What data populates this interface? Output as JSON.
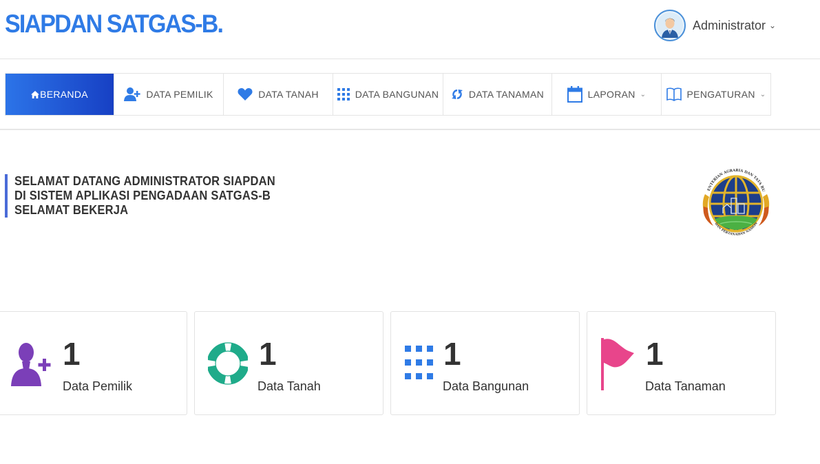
{
  "header": {
    "brand": "SIAPDAN SATGAS-B.",
    "user_name": "Administrator",
    "user_caret": "⌄"
  },
  "nav": {
    "items": [
      {
        "label": "BERANDA",
        "icon": "home-icon",
        "active": true
      },
      {
        "label": "DATA PEMILIK",
        "icon": "user-plus-icon"
      },
      {
        "label": "DATA TANAH",
        "icon": "heart-icon"
      },
      {
        "label": "DATA BANGUNAN",
        "icon": "grid-icon"
      },
      {
        "label": "DATA TANAMAN",
        "icon": "refresh-icon"
      },
      {
        "label": "LAPORAN",
        "icon": "calendar-icon",
        "dropdown": true
      },
      {
        "label": "PENGATURAN",
        "icon": "book-icon",
        "dropdown": true
      }
    ],
    "caret": "⌄"
  },
  "welcome": {
    "line1": "SELAMAT DATANG ADMINISTRATOR SIAPDAN",
    "line2": "DI SISTEM APLIKASI PENGADAAN SATGAS-B",
    "line3": "SELAMAT BEKERJA"
  },
  "logo": {
    "top_text": "KEMENTERIAN AGRARIA DAN TATA RUANG",
    "bottom_text": "BADAN PERTANAHAN NASIONAL"
  },
  "stats": [
    {
      "value": "1",
      "label": "Data Pemilik",
      "icon": "user-plus-icon",
      "color": "#7b3fb8"
    },
    {
      "value": "1",
      "label": "Data Tanah",
      "icon": "lifebuoy-icon",
      "color": "#1fab8a"
    },
    {
      "value": "1",
      "label": "Data Bangunan",
      "icon": "grid-icon",
      "color": "#2f7be6"
    },
    {
      "value": "1",
      "label": "Data Tanaman",
      "icon": "flag-icon",
      "color": "#e8458b"
    }
  ],
  "colors": {
    "brand": "#2f7be6",
    "nav_active_start": "#2c74e8",
    "nav_active_end": "#1740c4",
    "accent_bar": "#4a6bd8"
  }
}
